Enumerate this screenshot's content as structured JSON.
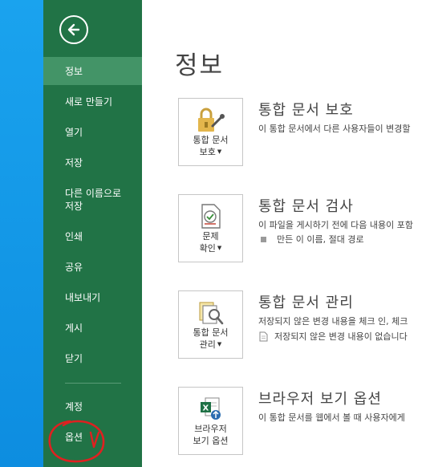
{
  "sidebar": {
    "items": [
      {
        "label": "정보",
        "selected": true
      },
      {
        "label": "새로 만들기"
      },
      {
        "label": "열기"
      },
      {
        "label": "저장"
      },
      {
        "label": "다른 이름으로\n저장"
      },
      {
        "label": "인쇄"
      },
      {
        "label": "공유"
      },
      {
        "label": "내보내기"
      },
      {
        "label": "게시"
      },
      {
        "label": "닫기"
      },
      {
        "label": "계정"
      },
      {
        "label": "옵션"
      }
    ]
  },
  "main": {
    "title": "정보",
    "sections": [
      {
        "button_label": "통합 문서\n보호",
        "heading": "통합 문서 보호",
        "description": "이 통합 문서에서 다른 사용자들이 변경할"
      },
      {
        "button_label": "문제\n확인",
        "heading": "통합 문서 검사",
        "description": "이 파일을 게시하기 전에 다음 내용이 포함",
        "sub_item": "만든 이 이름, 절대 경로"
      },
      {
        "button_label": "통합 문서\n관리",
        "heading": "통합 문서 관리",
        "description": "저장되지 않은 변경 내용을 체크 인, 체크",
        "sub_item": "저장되지 않은 변경 내용이 없습니다"
      },
      {
        "button_label": "브라우저\n보기 옵션",
        "heading": "브라우저 보기 옵션",
        "description": "이 통합 문서를 웹에서 볼 때 사용자에게"
      }
    ]
  },
  "colors": {
    "sidebar": "#217346",
    "sidebar_selected": "#439467",
    "desktop": "#1aa3ee",
    "annotation": "#e02020"
  }
}
